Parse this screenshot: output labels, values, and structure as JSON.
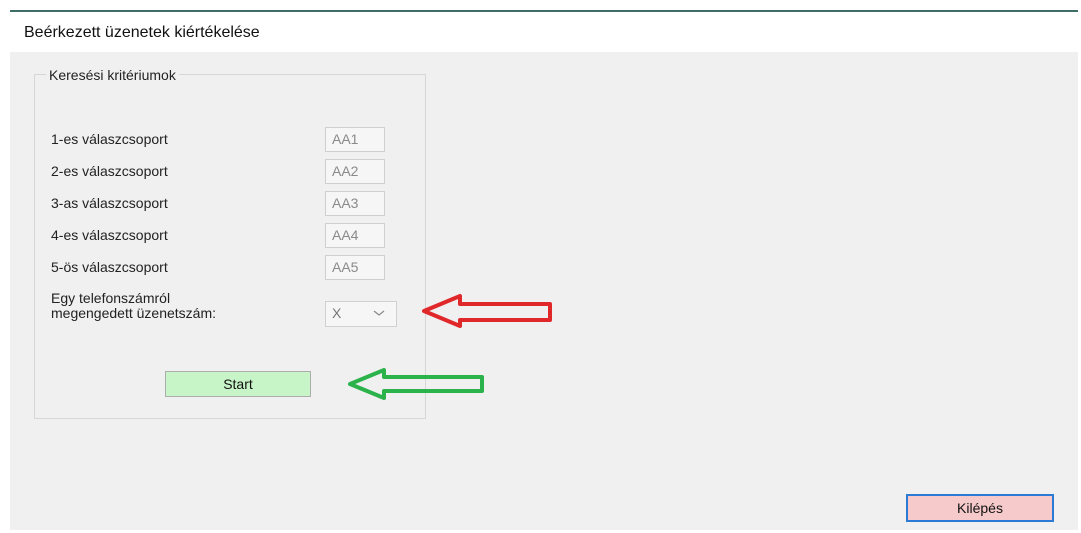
{
  "window": {
    "title": "Beérkezett üzenetek kiértékelése"
  },
  "search_group": {
    "legend": "Keresési kritériumok",
    "rows": [
      {
        "label": "1-es válaszcsoport",
        "value": "AA1"
      },
      {
        "label": "2-es válaszcsoport",
        "value": "AA2"
      },
      {
        "label": "3-as válaszcsoport",
        "value": "AA3"
      },
      {
        "label": "4-es válaszcsoport",
        "value": "AA4"
      },
      {
        "label": "5-ös válaszcsoport",
        "value": "AA5"
      }
    ],
    "limit": {
      "label_line1": "Egy telefonszámról",
      "label_line2": "megengedett üzenetszám:",
      "value": "X"
    },
    "start_label": "Start"
  },
  "footer": {
    "exit_label": "Kilépés"
  },
  "colors": {
    "start_bg": "#c8f5c8",
    "exit_bg": "#f6caca",
    "red_arrow": "#e0282a",
    "green_arrow": "#2bb24a"
  },
  "icons": {
    "combo": "chevron-down-icon"
  }
}
